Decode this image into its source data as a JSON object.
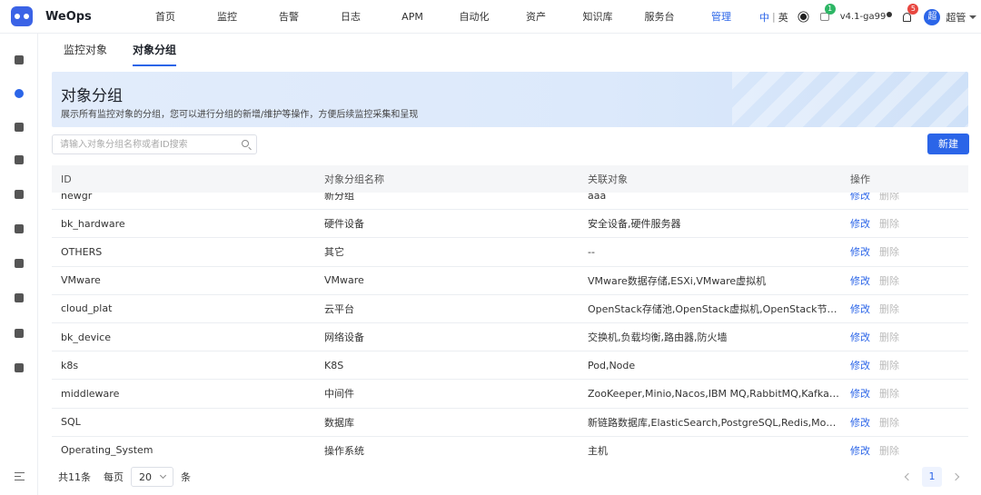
{
  "app": {
    "logo_text": "WeOps"
  },
  "nav": {
    "items": [
      "首页",
      "监控",
      "告警",
      "日志",
      "APM",
      "自动化",
      "资产",
      "知识库",
      "服务台",
      "管理"
    ],
    "active_index": 9
  },
  "top_right": {
    "lang_zh": "中",
    "lang_sep": "|",
    "lang_en": "英",
    "chat_badge": "1",
    "version": "v4.1-ga99",
    "bell_badge": "5",
    "avatar_text": "超",
    "user_name": "超管"
  },
  "sidebar": {
    "icons": [
      "cluster-icon",
      "monitor-icon",
      "chart-icon",
      "document-icon",
      "gauge-icon",
      "briefcase-icon",
      "layers-icon",
      "book-icon",
      "clipboard-icon",
      "settings-icon"
    ],
    "active_index": 1
  },
  "tabs": [
    "监控对象",
    "对象分组"
  ],
  "active_tab": 1,
  "banner": {
    "title": "对象分组",
    "description": "展示所有监控对象的分组，您可以进行分组的新增/维护等操作，方便后续监控采集和呈现"
  },
  "search": {
    "placeholder": "请输入对象分组名称或者ID搜索",
    "value": ""
  },
  "new_button": "新建",
  "table": {
    "columns": [
      "ID",
      "对象分组名称",
      "关联对象",
      "操作"
    ],
    "rows": [
      {
        "id": "newgr",
        "name": "新分组",
        "objects": "aaa",
        "edit": "修改",
        "delete": "删除"
      },
      {
        "id": "bk_hardware",
        "name": "硬件设备",
        "objects": "安全设备,硬件服务器",
        "edit": "修改",
        "delete": "删除"
      },
      {
        "id": "OTHERS",
        "name": "其它",
        "objects": "--",
        "edit": "修改",
        "delete": "删除"
      },
      {
        "id": "VMware",
        "name": "VMware",
        "objects": "VMware数据存储,ESXi,VMware虚拟机",
        "edit": "修改",
        "delete": "删除"
      },
      {
        "id": "cloud_plat",
        "name": "云平台",
        "objects": "OpenStack存储池,OpenStack虚拟机,OpenStack节点,CV...",
        "edit": "修改",
        "delete": "删除"
      },
      {
        "id": "bk_device",
        "name": "网络设备",
        "objects": "交换机,负载均衡,路由器,防火墙",
        "edit": "修改",
        "delete": "删除"
      },
      {
        "id": "k8s",
        "name": "K8S",
        "objects": "Pod,Node",
        "edit": "修改",
        "delete": "删除"
      },
      {
        "id": "middleware",
        "name": "中间件",
        "objects": "ZooKeeper,Minio,Nacos,IBM MQ,RabbitMQ,Kafka,Apac...",
        "edit": "修改",
        "delete": "删除"
      },
      {
        "id": "SQL",
        "name": "数据库",
        "objects": "新链路数据库,ElasticSearch,PostgreSQL,Redis,MongoDB,...",
        "edit": "修改",
        "delete": "删除"
      },
      {
        "id": "Operating_System",
        "name": "操作系统",
        "objects": "主机",
        "edit": "修改",
        "delete": "删除"
      }
    ]
  },
  "pagination": {
    "total_text": "共11条",
    "per_page_label": "每页",
    "page_size": "20",
    "unit": "条",
    "current_page": "1"
  },
  "colors": {
    "primary": "#2b65e8",
    "disabled_link": "#bbbbbb"
  }
}
